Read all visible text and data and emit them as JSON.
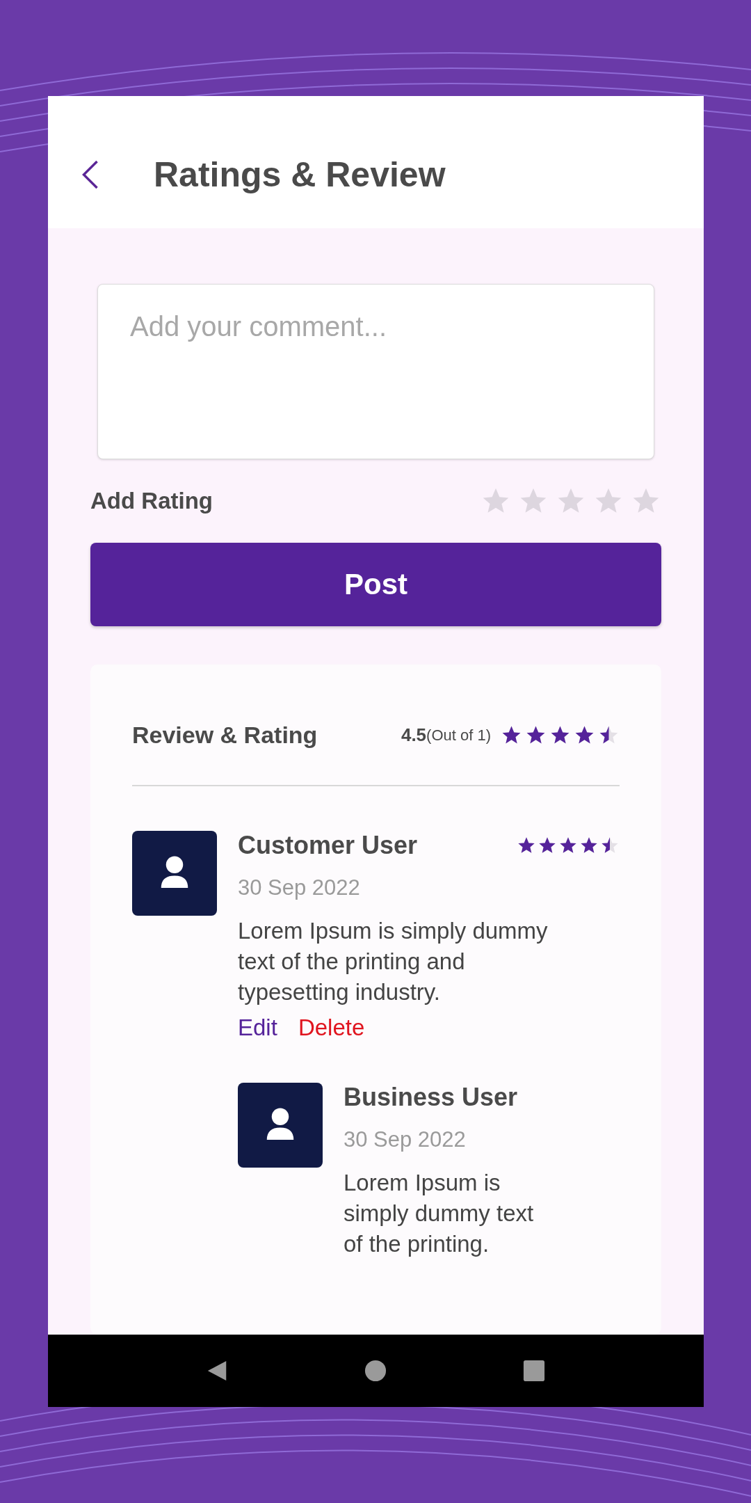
{
  "header": {
    "title": "Ratings & Review"
  },
  "comment": {
    "placeholder": "Add your comment..."
  },
  "add_rating": {
    "label": "Add Rating",
    "stars": 0
  },
  "post_button": {
    "label": "Post"
  },
  "reviews_card": {
    "title": "Review & Rating",
    "score": "4.5",
    "score_note": "(Out of 1)",
    "stars": 4.5,
    "reviews": [
      {
        "name": "Customer User",
        "date": "30 Sep 2022",
        "text": "Lorem Ipsum is simply dummy text of the printing and typesetting industry.",
        "stars": 4.5,
        "actions": [
          {
            "label": "Edit",
            "kind": "edit"
          },
          {
            "label": "Delete",
            "kind": "delete"
          }
        ],
        "replies": [
          {
            "name": "Business User",
            "date": "30 Sep 2022",
            "text": "Lorem Ipsum is simply dummy text of the printing."
          }
        ]
      }
    ]
  }
}
